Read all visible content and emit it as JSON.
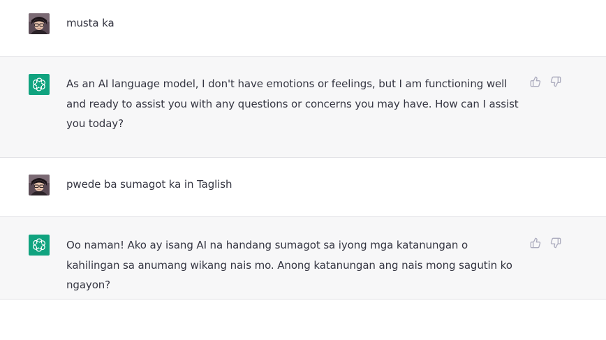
{
  "conversation": {
    "messages": [
      {
        "role": "user",
        "text": "musta ka"
      },
      {
        "role": "assistant",
        "text": "As an AI language model, I don't have emotions or feelings, but I am functioning well and ready to assist you with any questions or concerns you may have. How can I assist you today?"
      },
      {
        "role": "user",
        "text": "pwede ba sumagot ka in Taglish"
      },
      {
        "role": "assistant",
        "text": "Oo naman! Ako ay isang AI na handang sumagot sa iyong mga katanungan o kahilingan sa anumang wikang nais mo. Anong katanungan ang nais mong sagutin ko ngayon?"
      }
    ]
  },
  "icons": {
    "assistant_avatar": "openai-logo-icon",
    "user_avatar": "user-photo",
    "thumbs_up": "thumbs-up-icon",
    "thumbs_down": "thumbs-down-icon"
  },
  "colors": {
    "assistant_avatar_bg": "#10a37f",
    "assistant_row_bg": "#f7f7f8",
    "user_row_bg": "#ffffff",
    "text": "#343541",
    "icon": "#acacbe",
    "divider": "#e2e2e6"
  }
}
